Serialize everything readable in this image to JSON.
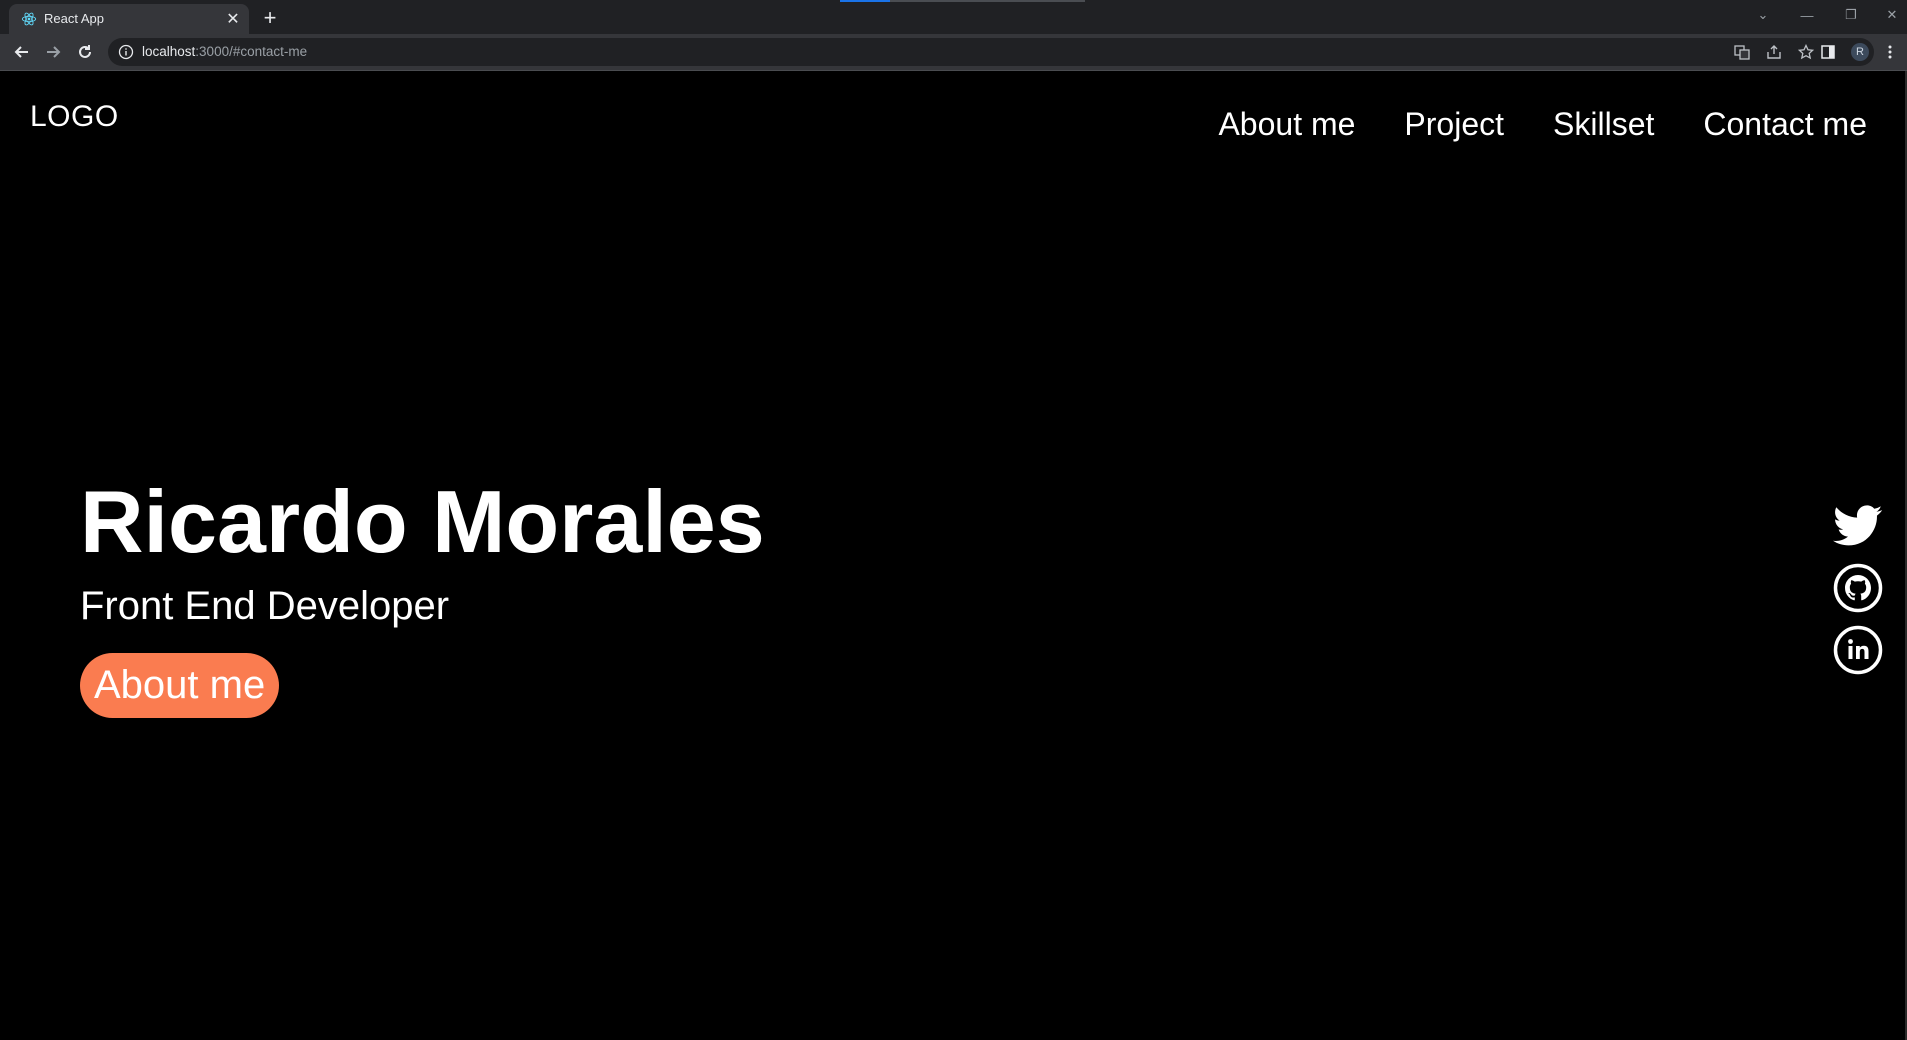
{
  "browser": {
    "tab_title": "React App",
    "url_host": "localhost",
    "url_rest": ":3000/#contact-me",
    "profile_initial": "R"
  },
  "site": {
    "logo": "LOGO",
    "nav": [
      "About me",
      "Project",
      "Skillset",
      "Contact me"
    ],
    "hero": {
      "name": "Ricardo Morales",
      "role": "Front End Developer",
      "button": "About me"
    },
    "socials": [
      "twitter-icon",
      "github-icon",
      "linkedin-icon"
    ]
  },
  "colors": {
    "background": "#000000",
    "accent_button": "#fa7c50",
    "text": "#ffffff"
  }
}
